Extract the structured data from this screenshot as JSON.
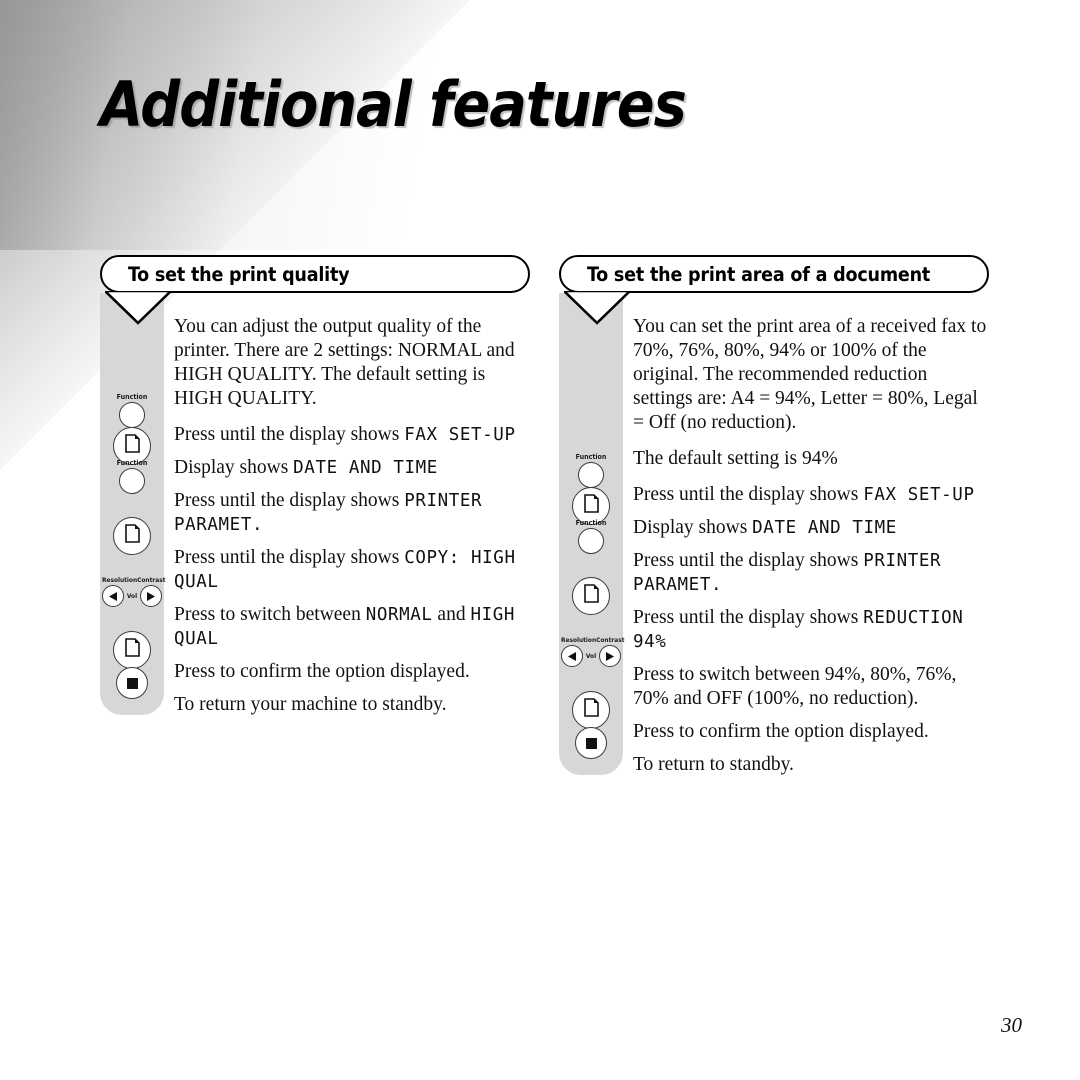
{
  "page": {
    "title": "Additional features",
    "page_number": "30",
    "accent_gray": "#d7d7d7",
    "text_color": "#111111"
  },
  "icons": {
    "function_label": "Function",
    "resolution_label": "Resolution",
    "contrast_label": "Contrast",
    "vol_label": "Vol",
    "document_icon": "document-page-icon",
    "stop_icon": "stop-square-icon",
    "left_arrow_icon": "triangle-left-icon",
    "right_arrow_icon": "triangle-right-icon"
  },
  "sections": [
    {
      "id": "print-quality",
      "header": "To set the print quality",
      "intro": [
        "You can adjust the output quality of the printer. There are 2 settings: NORMAL and HIGH QUALITY. The default setting is HIGH QUALITY."
      ],
      "steps": [
        {
          "button": "function",
          "label": "Function",
          "text_before": "Press until the display shows ",
          "lcd": "FAX SET-UP",
          "text_after": ""
        },
        {
          "button": "document",
          "label": "",
          "text_before": "Display shows ",
          "lcd": "DATE AND TIME",
          "text_after": ""
        },
        {
          "button": "function",
          "label": "Function",
          "text_before": "Press until the display shows ",
          "lcd": "PRINTER PARAMET.",
          "text_after": ""
        },
        {
          "button": "document",
          "label": "",
          "text_before": "Press until the display shows ",
          "lcd": "COPY: HIGH QUAL",
          "text_after": ""
        },
        {
          "button": "arrows",
          "label": "",
          "text_before": "Press to switch between ",
          "lcd": "NORMAL",
          "text_mid": " and ",
          "lcd2": "HIGH QUAL",
          "text_after": ""
        },
        {
          "button": "document",
          "label": "",
          "text_before": "Press to confirm the option displayed.",
          "lcd": "",
          "text_after": ""
        },
        {
          "button": "stop",
          "label": "",
          "text_before": "To return your machine to standby.",
          "lcd": "",
          "text_after": ""
        }
      ]
    },
    {
      "id": "print-area",
      "header": "To set the print area of a document",
      "intro": [
        "You can set the print area of a received fax to 70%, 76%, 80%, 94% or 100% of the original. The recommended reduction settings are: A4 = 94%, Letter = 80%, Legal = Off (no reduction).",
        "The default setting is 94%"
      ],
      "steps": [
        {
          "button": "function",
          "label": "Function",
          "text_before": "Press until the display shows ",
          "lcd": "FAX SET-UP",
          "text_after": ""
        },
        {
          "button": "document",
          "label": "",
          "text_before": "Display shows ",
          "lcd": "DATE AND TIME",
          "text_after": ""
        },
        {
          "button": "function",
          "label": "Function",
          "text_before": "Press until the display shows ",
          "lcd": "PRINTER PARAMET.",
          "text_after": ""
        },
        {
          "button": "document",
          "label": "",
          "text_before": "Press until the display shows ",
          "lcd": "REDUCTION 94%",
          "text_after": ""
        },
        {
          "button": "arrows",
          "label": "",
          "text_before": "Press to switch between 94%, 80%, 76%, 70% and OFF (100%, no reduction).",
          "lcd": "",
          "text_after": ""
        },
        {
          "button": "document",
          "label": "",
          "text_before": "Press to confirm the option displayed.",
          "lcd": "",
          "text_after": ""
        },
        {
          "button": "stop",
          "label": "",
          "text_before": "To return to standby.",
          "lcd": "",
          "text_after": ""
        }
      ]
    }
  ]
}
